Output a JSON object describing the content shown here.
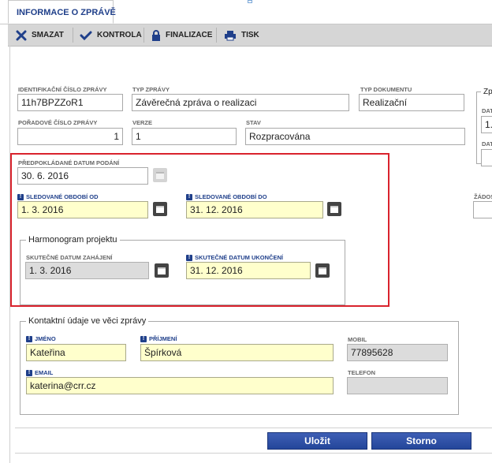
{
  "tab": {
    "title": "INFORMACE O ZPRÁVĚ"
  },
  "toolbar": {
    "delete_label": "SMAZAT",
    "check_label": "KONTROLA",
    "finalize_label": "FINALIZACE",
    "print_label": "TISK"
  },
  "fields": {
    "id_label": "IDENTIFIKAČNÍ ČÍSLO ZPRÁVY",
    "id_value": "11h7BPZZoR1",
    "type_label": "TYP ZPRÁVY",
    "type_value": "Závěrečná zpráva o realizaci",
    "doc_type_label": "TYP DOKUMENTU",
    "doc_type_value": "Realizační",
    "order_label": "POŘADOVÉ ČÍSLO ZPRÁVY",
    "order_value": "1",
    "version_label": "VERZE",
    "version_value": "1",
    "state_label": "STAV",
    "state_value": "Rozpracována",
    "expected_date_label": "PŘEDPOKLÁDANÉ DATUM PODÁNÍ",
    "expected_date_value": "30. 6. 2016",
    "period_from_label": "SLEDOVANÉ OBDOBÍ OD",
    "period_from_value": "1. 3. 2016",
    "period_to_label": "SLEDOVANÉ OBDOBÍ DO",
    "period_to_value": "31. 12. 2016"
  },
  "harmonogram": {
    "legend": "Harmonogram projektu",
    "start_label": "SKUTEČNÉ DATUM ZAHÁJENÍ",
    "start_value": "1. 3. 2016",
    "end_label": "SKUTEČNÉ DATUM UKONČENÍ",
    "end_value": "31. 12. 2016"
  },
  "contact": {
    "legend": "Kontaktní údaje ve věci zprávy",
    "first_name_label": "JMÉNO",
    "first_name_value": "Kateřina",
    "last_name_label": "PŘÍJMENÍ",
    "last_name_value": "Špírková",
    "mobile_label": "MOBIL",
    "mobile_value": "77895628",
    "email_label": "EMAIL",
    "email_value": "katerina@crr.cz",
    "phone_label": "TELEFON",
    "phone_value": ""
  },
  "right_panel": {
    "legend_fragment": "Zp",
    "label1_fragment": "DAT",
    "value1_fragment": "1.",
    "label2_fragment": "DAT",
    "label3_fragment": "ŽÁDOS"
  },
  "buttons": {
    "save_label": "Uložit",
    "cancel_label": "Storno"
  },
  "required_marker": "!",
  "colors": {
    "accent": "#1f3f8a",
    "required_bg": "#ffffcc",
    "highlight_border": "#d9232d",
    "button": "#2a4ca3"
  }
}
